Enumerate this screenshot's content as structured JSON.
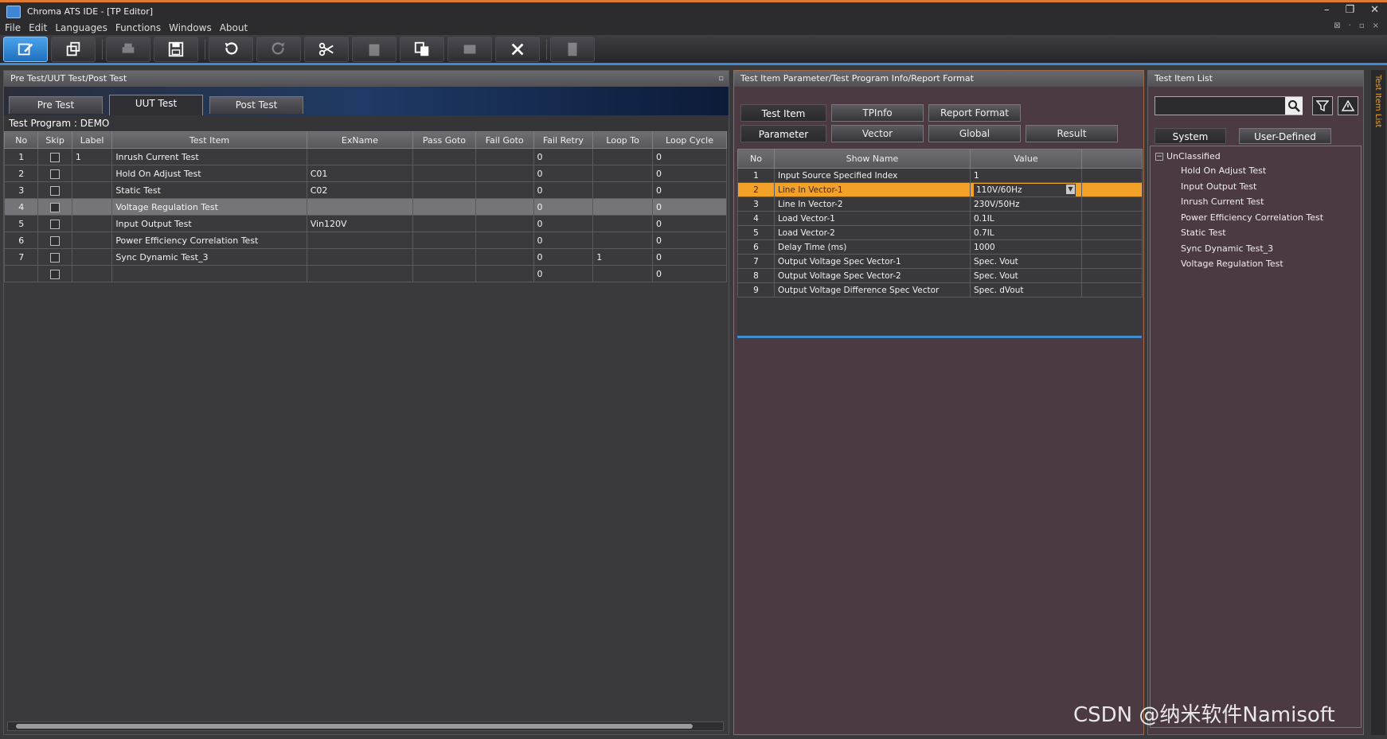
{
  "window": {
    "title": "Chroma ATS IDE - [TP Editor]",
    "controls": [
      "–",
      "❐",
      "✕"
    ],
    "mdi_controls": [
      "⊠",
      "·",
      "▫",
      "×"
    ]
  },
  "menu": [
    "File",
    "Edit",
    "Languages",
    "Functions",
    "Windows",
    "About"
  ],
  "toolbar": {
    "buttons": [
      {
        "icon": "edit-icon",
        "active": true
      },
      {
        "icon": "open-icon",
        "active": false
      },
      {
        "icon": "print-icon",
        "active": false
      },
      {
        "icon": "save-icon",
        "active": false
      },
      {
        "icon": "undo-icon",
        "active": false
      },
      {
        "icon": "redo-icon",
        "active": false
      },
      {
        "icon": "cut-icon",
        "active": false
      },
      {
        "icon": "paste-icon",
        "active": false
      },
      {
        "icon": "copy-icon",
        "active": false
      },
      {
        "icon": "link-icon",
        "active": false
      },
      {
        "icon": "delete-icon",
        "active": false
      },
      {
        "icon": "document-icon",
        "active": false
      }
    ]
  },
  "left_panel": {
    "header": "Pre Test/UUT Test/Post Test",
    "tabs": [
      "Pre Test",
      "UUT Test",
      "Post Test"
    ],
    "active_tab": "UUT Test",
    "program_label": "Test Program : DEMO",
    "columns": [
      "No",
      "Skip",
      "Label",
      "Test Item",
      "ExName",
      "Pass Goto",
      "Fail Goto",
      "Fail Retry",
      "Loop To",
      "Loop Cycle"
    ],
    "rows": [
      {
        "no": "1",
        "label": "1",
        "item": "Inrush Current Test",
        "exname": "",
        "pass": "",
        "fail": "",
        "retry": "0",
        "loopto": "",
        "cycle": "0"
      },
      {
        "no": "2",
        "label": "",
        "item": "Hold On Adjust Test",
        "exname": "C01",
        "pass": "",
        "fail": "",
        "retry": "0",
        "loopto": "",
        "cycle": "0"
      },
      {
        "no": "3",
        "label": "",
        "item": "Static Test",
        "exname": "C02",
        "pass": "",
        "fail": "",
        "retry": "0",
        "loopto": "",
        "cycle": "0"
      },
      {
        "no": "4",
        "label": "",
        "item": "Voltage Regulation Test",
        "exname": "",
        "pass": "",
        "fail": "",
        "retry": "0",
        "loopto": "",
        "cycle": "0"
      },
      {
        "no": "5",
        "label": "",
        "item": "Input Output Test",
        "exname": "Vin120V",
        "pass": "",
        "fail": "",
        "retry": "0",
        "loopto": "",
        "cycle": "0"
      },
      {
        "no": "6",
        "label": "",
        "item": "Power Efficiency Correlation Test",
        "exname": "",
        "pass": "",
        "fail": "",
        "retry": "0",
        "loopto": "",
        "cycle": "0"
      },
      {
        "no": "7",
        "label": "",
        "item": "Sync Dynamic Test_3",
        "exname": "",
        "pass": "",
        "fail": "",
        "retry": "0",
        "loopto": "1",
        "cycle": "0"
      },
      {
        "no": "",
        "label": "",
        "item": "",
        "exname": "",
        "pass": "",
        "fail": "",
        "retry": "0",
        "loopto": "",
        "cycle": "0"
      }
    ]
  },
  "mid_panel": {
    "header": "Test Item Parameter/Test Program Info/Report Format",
    "row1": [
      "Test Item",
      "TPInfo",
      "Report Format"
    ],
    "row2": [
      "Parameter",
      "Vector",
      "Global",
      "Result"
    ],
    "columns": [
      "No",
      "Show Name",
      "Value"
    ],
    "params": [
      {
        "no": "1",
        "name": "Input Source Specified Index",
        "value": "1"
      },
      {
        "no": "2",
        "name": "Line In Vector-1",
        "value": "110V/60Hz"
      },
      {
        "no": "3",
        "name": "Line In Vector-2",
        "value": "230V/50Hz"
      },
      {
        "no": "4",
        "name": "Load Vector-1",
        "value": "0.1IL"
      },
      {
        "no": "5",
        "name": "Load Vector-2",
        "value": "0.7IL"
      },
      {
        "no": "6",
        "name": "Delay Time (ms)",
        "value": "1000"
      },
      {
        "no": "7",
        "name": "Output Voltage Spec Vector-1",
        "value": "Spec. Vout"
      },
      {
        "no": "8",
        "name": "Output Voltage Spec Vector-2",
        "value": "Spec. Vout"
      },
      {
        "no": "9",
        "name": "Output Voltage Difference Spec Vector",
        "value": "Spec. dVout"
      }
    ]
  },
  "right_panel": {
    "header": "Test Item List",
    "tabs": [
      "System",
      "User-Defined"
    ],
    "root": "UnClassified",
    "items": [
      "Hold On Adjust Test",
      "Input Output Test",
      "Inrush Current Test",
      "Power Efficiency Correlation Test",
      "Static Test",
      "Sync Dynamic Test_3",
      "Voltage Regulation Test"
    ],
    "side_label": "Test Item List"
  },
  "watermark": "CSDN @纳米软件Namisoft",
  "colors": {
    "accent_orange": "#f4a12a",
    "accent_blue": "#3b8bd4",
    "panel_maroon": "#4b3a42"
  }
}
